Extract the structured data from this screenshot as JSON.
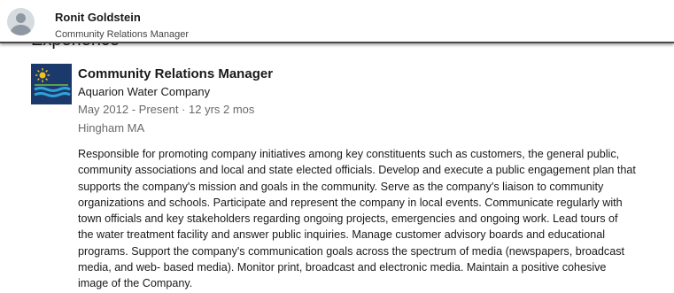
{
  "header": {
    "name": "Ronit Goldstein",
    "headline": "Community Relations Manager"
  },
  "section": {
    "heading": "Experience"
  },
  "experience": {
    "title": "Community Relations Manager",
    "company": "Aquarion Water Company",
    "dates": "May 2012 - Present · 12 yrs 2 mos",
    "location": "Hingham MA",
    "description_lines": [
      "Responsible for promoting company initiatives among key constituents such as customers, the general public,",
      "community associations and local and state elected officials. Develop and execute a public engagement plan that",
      "supports the company's mission and goals in the community. Serve as the company's liaison to community",
      "organizations and schools. Participate and represent the company in local events. Communicate regularly with",
      "town officials and key stakeholders regarding ongoing projects, emergencies and ongoing work. Lead tours of",
      "the water treatment facility and answer public inquiries. Manage customer advisory boards and educational",
      "programs. Support the company's communication goals across the spectrum of media (newspapers, broadcast",
      "media, and web- based media). Monitor print, broadcast and electronic media. Maintain a positive cohesive",
      "image of the Company."
    ]
  },
  "icons": {
    "avatar": "person-icon",
    "logo": "aquarion-logo"
  },
  "colors": {
    "logo_background": "#1b3a6b",
    "logo_sun": "#f2c21b",
    "logo_water": "#2fa3d8",
    "secondary_text": "rgba(0,0,0,0.6)"
  }
}
